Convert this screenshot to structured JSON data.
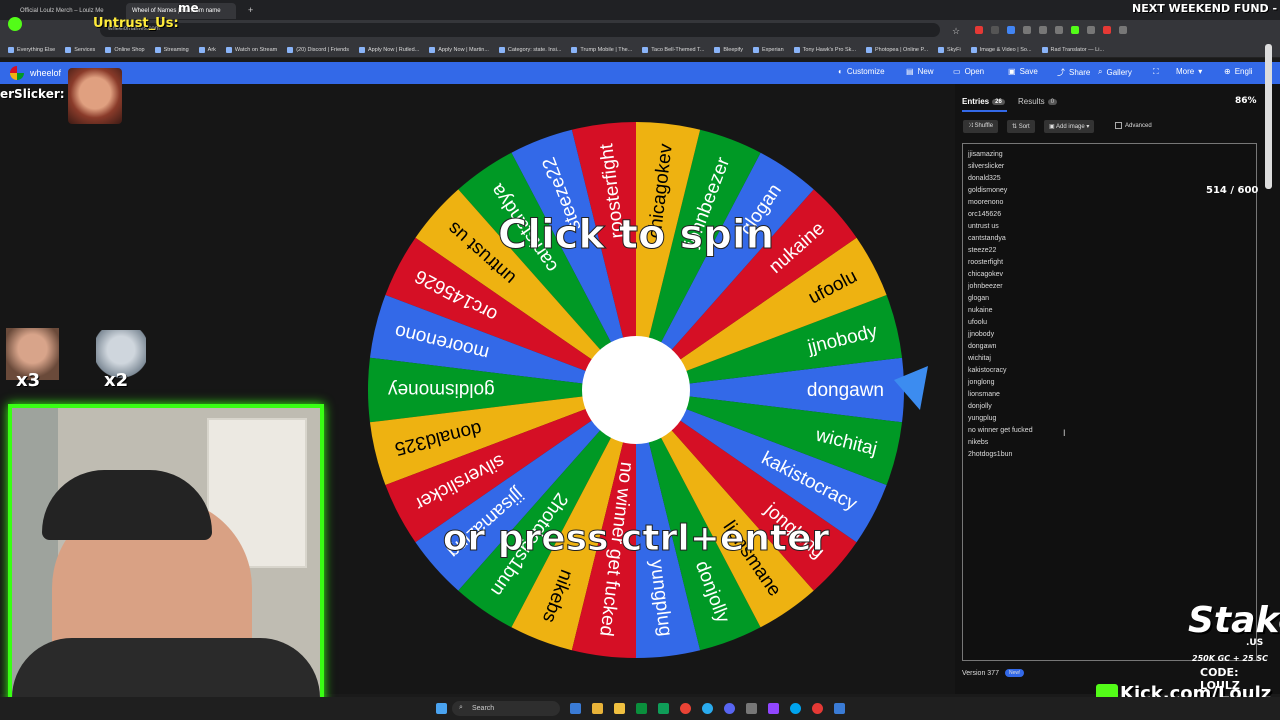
{
  "browser": {
    "tabs": [
      {
        "label": "Official Loulz Merch – Loulz Me"
      },
      {
        "label": "Wheel of Names | Random name"
      }
    ],
    "address": "wheelofnames.com",
    "bookmarks": [
      "Everything Else",
      "Services",
      "Online Shop",
      "Streaming",
      "Ark",
      "Watch on Stream",
      "(20) Discord | Friends",
      "Apply Now | Rutled...",
      "Apply Now | Martin...",
      "Category: state. Insi...",
      "Trump Mobile | The...",
      "Taco Bell-Themed T...",
      "Bleepify",
      "Experian",
      "Tony Hawk's Pro Sk...",
      "Photopea | Online P...",
      "SkyFi",
      "Image & Video | So...",
      "Rad Translator — Li..."
    ]
  },
  "app": {
    "logo_text": "wheelof",
    "menu": [
      {
        "label": "Customize",
        "icon": "palette-icon"
      },
      {
        "label": "New",
        "icon": "file-icon"
      },
      {
        "label": "Open",
        "icon": "folder-icon"
      },
      {
        "label": "Save",
        "icon": "save-icon"
      },
      {
        "label": "Share",
        "icon": "share-icon"
      },
      {
        "label": "Gallery",
        "icon": "search-icon"
      },
      {
        "label": "",
        "icon": "fullscreen-icon"
      },
      {
        "label": "More",
        "icon": "chevron-down-icon"
      },
      {
        "label": "Engli",
        "icon": "globe-icon"
      }
    ]
  },
  "wheel": {
    "click_text": "Click to spin",
    "press_text": "or press ctrl+enter",
    "colors": [
      "#3369e8",
      "#009925",
      "#eeb211",
      "#d50f25"
    ],
    "segments": [
      "dongawn",
      "jjnobody",
      "ufoolu",
      "nukaine",
      "glogan",
      "johnbeezer",
      "chicagokev",
      "roosterfight",
      "steeze22",
      "cantstandya",
      "untrust us",
      "orc145626",
      "moorenono",
      "goldismoney",
      "donald325",
      "silverslicker",
      "jjisamazing",
      "2hotdogs1bun",
      "nikebs",
      "no winner get fucked",
      "yungplug",
      "donjolly",
      "lionsmane",
      "jonglong",
      "kakistocracy",
      "wichitaj"
    ]
  },
  "panel": {
    "tab_entries": "Entries",
    "entries_count": "26",
    "tab_results": "Results",
    "results_count": "0",
    "shuffle": "Shuffle",
    "sort": "Sort",
    "add_image": "Add image",
    "advanced": "Advanced",
    "entries": [
      "jjisamazing",
      "silverslicker",
      "donald325",
      "goldismoney",
      "moorenono",
      "orc145626",
      "untrust us",
      "cantstandya",
      "steeze22",
      "roosterfight",
      "chicagokev",
      "johnbeezer",
      "glogan",
      "nukaine",
      "ufoolu",
      "jjnobody",
      "dongawn",
      "wichitaj",
      "kakistocracy",
      "jonglong",
      "lionsmane",
      "donjolly",
      "yungplug",
      "no winner get fucked",
      "nikebs",
      "2hotdogs1bun"
    ],
    "version": "Version 377",
    "new_badge": "New!"
  },
  "stream": {
    "next_fund": "NEXT WEEKEND FUND -",
    "fund_progress": "514 / 600",
    "chat_user": "Untrust_Us:",
    "chat_user2": "erSlicker:",
    "chat_me": "me",
    "multiplier_x3": "x3",
    "multiplier_x2": "x2",
    "stake_brand": "Stake",
    "stake_us": ".US",
    "stake_promo": "250K GC + 25 SC",
    "stake_code": "CODE: LOULZ",
    "kick": "Kick.com/Loulz",
    "percent": "86%"
  },
  "taskbar": {
    "search": "Search"
  }
}
